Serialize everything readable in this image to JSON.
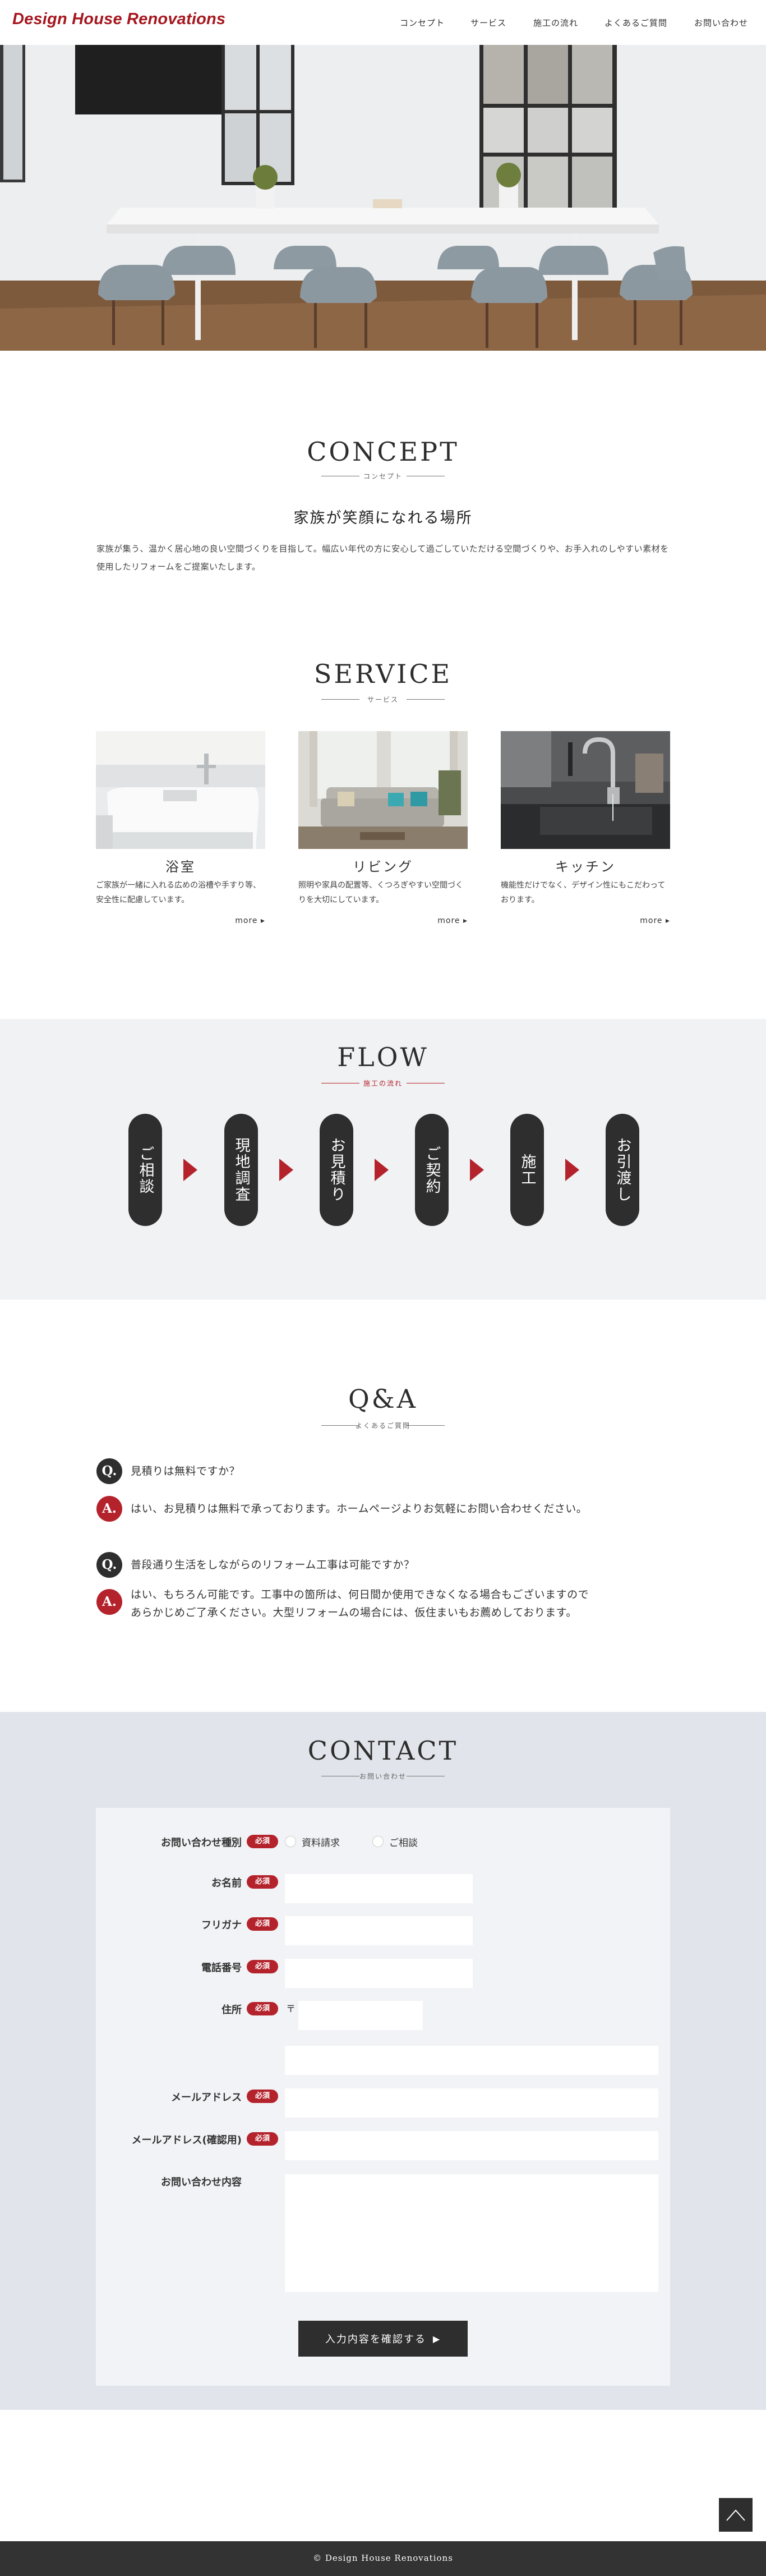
{
  "header": {
    "logo": "Design House Renovations",
    "nav": [
      "コンセプト",
      "サービス",
      "施工の流れ",
      "よくあるご質問",
      "お問い合わせ"
    ]
  },
  "concept": {
    "title": "CONCEPT",
    "subtitle": "コンセプト",
    "heading": "家族が笑顔になれる場所",
    "body": "家族が集う、温かく居心地の良い空間づくりを目指して。幅広い年代の方に安心して過ごしていただける空間づくりや、お手入れのしやすい素材を使用したリフォームをご提案いたします。"
  },
  "service": {
    "title": "SERVICE",
    "subtitle": "サービス",
    "items": [
      {
        "name": "浴室",
        "desc": "ご家族が一緒に入れる広めの浴槽や手すり等、安全性に配慮しています。",
        "more": "more"
      },
      {
        "name": "リビング",
        "desc": "照明や家具の配置等、くつろぎやすい空間づくりを大切にしています。",
        "more": "more"
      },
      {
        "name": "キッチン",
        "desc": "機能性だけでなく、デザイン性にもこだわっております。",
        "more": "more"
      }
    ]
  },
  "flow": {
    "title": "FLOW",
    "subtitle": "施工の流れ",
    "steps": [
      "ご相談",
      "現地調査",
      "お見積り",
      "ご契約",
      "施工",
      "お引渡し"
    ]
  },
  "qa": {
    "title": "Q&A",
    "subtitle": "よくあるご質問",
    "q_badge": "Q.",
    "a_badge": "A.",
    "items": [
      {
        "q": "見積りは無料ですか？",
        "a": "はい、お見積りは無料で承っております。ホームページよりお気軽にお問い合わせください。"
      },
      {
        "q": "普段通り生活をしながらのリフォーム工事は可能ですか？",
        "a_line1": "はい、もちろん可能です。工事中の箇所は、何日間か使用できなくなる場合もございますので",
        "a_line2": "あらかじめご了承ください。大型リフォームの場合には、仮住まいもお薦めしております。"
      }
    ]
  },
  "contact": {
    "title": "CONTACT",
    "subtitle": "お問い合わせ",
    "required": "必須",
    "fields": {
      "type": "お問い合わせ種別",
      "name": "お名前",
      "kana": "フリガナ",
      "tel": "電話番号",
      "address": "住所",
      "email": "メールアドレス",
      "email_confirm": "メールアドレス(確認用)",
      "message": "お問い合わせ内容"
    },
    "type_options": [
      "資料請求",
      "ご相談"
    ],
    "postal_mark": "〒",
    "submit": "入力内容を確認する"
  },
  "footer": {
    "copyright": "© Design House Renovations"
  },
  "colors": {
    "accent": "#b4232c",
    "dark": "#2e2e2e",
    "flow_bg": "#f1f2f4",
    "contact_bg": "#e1e4ea"
  },
  "icons": [
    "arrow-right-icon",
    "chevron-up-icon"
  ]
}
